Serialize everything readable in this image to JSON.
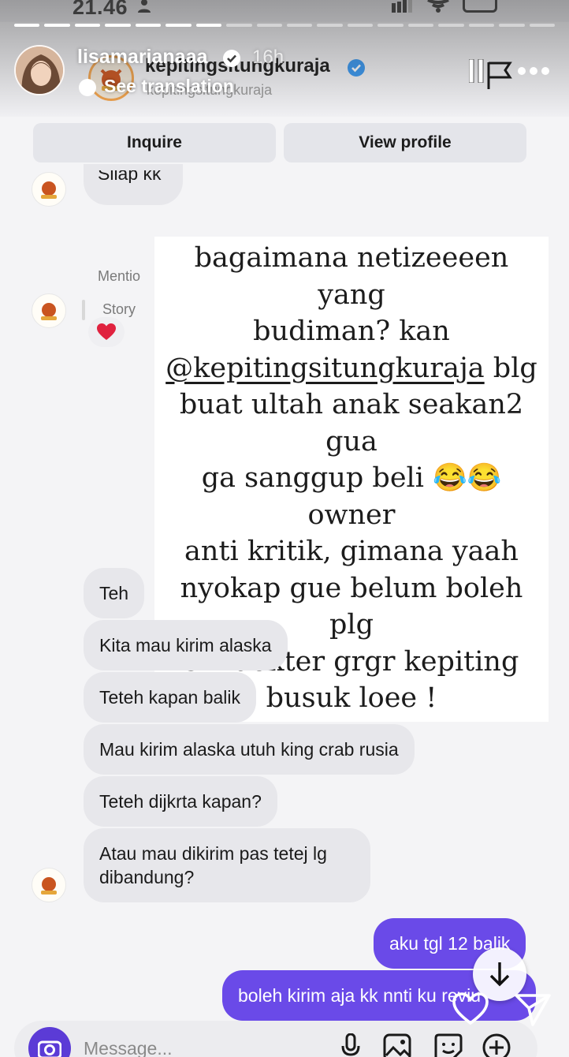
{
  "status_bar": {
    "time": "21.46"
  },
  "story": {
    "username": "lisamarianaaa",
    "time_ago": "16h",
    "translate_label": "See translation",
    "progress_total": 18,
    "progress_done": 7
  },
  "inner_header": {
    "shop_name": "kepitingsitungkuraja",
    "shop_subtitle": "kepitingsitungkuraja"
  },
  "buttons": {
    "inquire": "Inquire",
    "view_profile": "View profile"
  },
  "chat": {
    "first_message": "Siiap kk",
    "mention_label": "Mentio",
    "story_label": "Story",
    "reaction": "❤️",
    "incoming": [
      "Teh",
      "Kita mau kirim alaska",
      "Teteh kapan balik",
      "Mau kirim  alaska utuh king crab rusia",
      "Teteh dijkrta kapan?"
    ],
    "incoming_last_line1": "Atau mau dikirim pas tetej lg",
    "incoming_last_line2": "dibandung?",
    "outgoing": [
      "aku tgl 12 balik",
      "boleh kirim aja kk nnti ku reviu"
    ]
  },
  "caption": {
    "line1": "bagaimana netizeeeen yang",
    "line2": "budiman? kan",
    "mention": "@kepitingsitungkuraja",
    "line3_rest": " blg",
    "line4": "buat ultah anak seakan2 gua",
    "line5_before": "ga sanggup beli ",
    "emoji": "😂😂",
    "line5_after": " owner",
    "line6": "anti kritik, gimana yaah",
    "line7": "nyokap gue belum boleh plg",
    "line8": "sm dokter grgr kepiting",
    "line9": "busuk loee !"
  },
  "composer": {
    "placeholder": "Message..."
  },
  "colors": {
    "accent_purple": "#6a4ae8",
    "camera_purple": "#5b3bd6",
    "verified_blue": "#3897f0",
    "bubble_gray": "#e7e7eb"
  },
  "icons": [
    "person-icon",
    "signal-icon",
    "wifi-icon",
    "battery-icon",
    "verified-icon",
    "pause-icon",
    "flag-icon",
    "more-icon",
    "camera-icon",
    "mic-icon",
    "image-icon",
    "sticker-icon",
    "plus-icon",
    "arrow-down-icon",
    "heart-icon",
    "send-icon"
  ]
}
